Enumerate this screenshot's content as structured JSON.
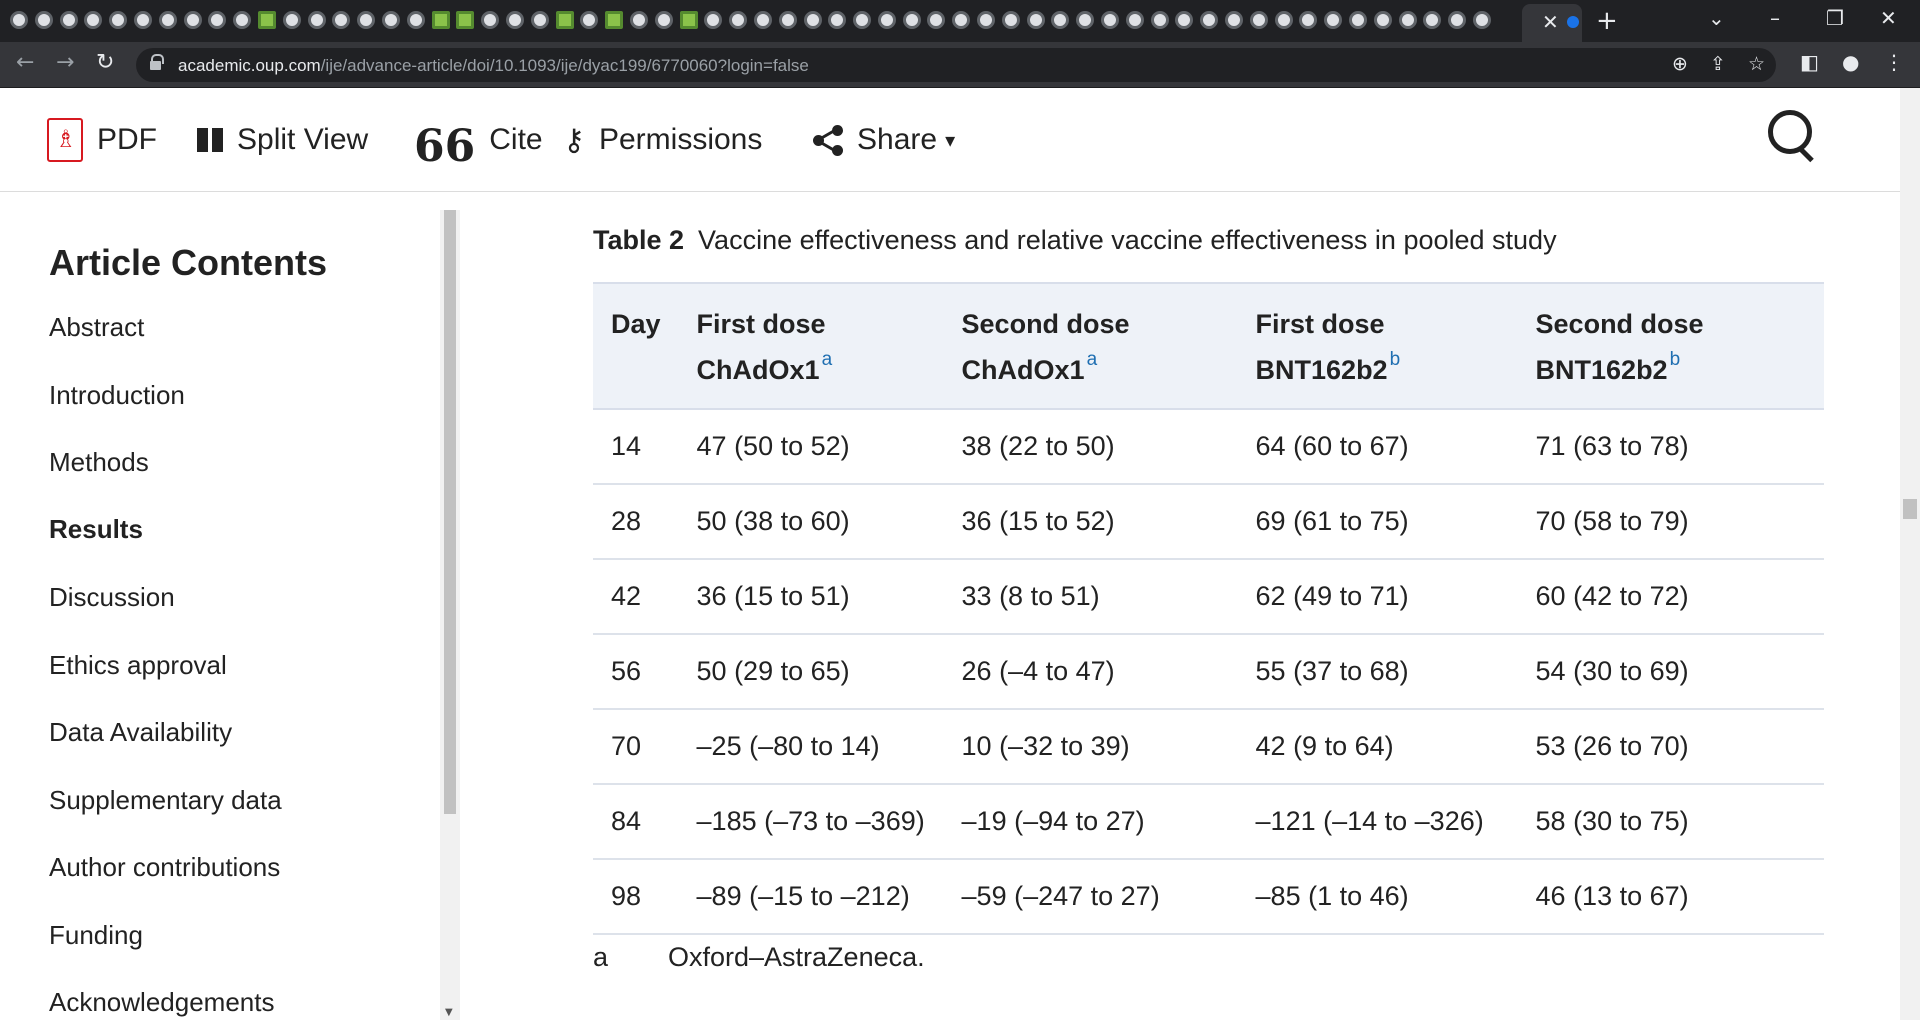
{
  "browser": {
    "url_host": "academic.oup.com",
    "url_path": "/ije/advance-article/doi/10.1093/ije/dyac199/6770060?login=false",
    "close_glyph": "✕",
    "newtab_glyph": "+"
  },
  "toolbar": {
    "pdf_label": "PDF",
    "split_label": "Split View",
    "cite_label": "Cite",
    "cite_glyph": "66",
    "permissions_label": "Permissions",
    "share_label": "Share",
    "share_caret": "▾"
  },
  "sidebar": {
    "title": "Article Contents",
    "items": [
      {
        "label": "Abstract",
        "active": false
      },
      {
        "label": "Introduction",
        "active": false
      },
      {
        "label": "Methods",
        "active": false
      },
      {
        "label": "Results",
        "active": true
      },
      {
        "label": "Discussion",
        "active": false
      },
      {
        "label": "Ethics approval",
        "active": false
      },
      {
        "label": "Data Availability",
        "active": false
      },
      {
        "label": "Supplementary data",
        "active": false
      },
      {
        "label": "Author contributions",
        "active": false
      },
      {
        "label": "Funding",
        "active": false
      },
      {
        "label": "Acknowledgements",
        "active": false
      }
    ]
  },
  "table": {
    "label": "Table 2",
    "caption": "Vaccine effectiveness and relative vaccine effectiveness in pooled study",
    "headers": [
      {
        "line1": "Day",
        "line2": "",
        "sup": ""
      },
      {
        "line1": "First dose",
        "line2": "ChAdOx1",
        "sup": "a"
      },
      {
        "line1": "Second dose",
        "line2": "ChAdOx1",
        "sup": "a"
      },
      {
        "line1": "First dose",
        "line2": "BNT162b2",
        "sup": "b"
      },
      {
        "line1": "Second dose",
        "line2": "BNT162b2",
        "sup": "b"
      }
    ],
    "rows": [
      [
        "14",
        "47 (50 to 52)",
        "38 (22 to 50)",
        "64 (60 to 67)",
        "71 (63 to 78)"
      ],
      [
        "28",
        "50 (38 to 60)",
        "36 (15 to 52)",
        "69 (61 to 75)",
        "70 (58 to 79)"
      ],
      [
        "42",
        "36 (15 to 51)",
        "33 (8 to 51)",
        "62 (49 to 71)",
        "60 (42 to 72)"
      ],
      [
        "56",
        "50 (29 to 65)",
        "26 (–4 to 47)",
        "55 (37 to 68)",
        "54 (30 to 69)"
      ],
      [
        "70",
        "–25 (–80 to 14)",
        "10 (–32 to 39)",
        "42 (9 to 64)",
        "53 (26 to 70)"
      ],
      [
        "84",
        "–185 (–73 to –369)",
        "–19 (–94 to 27)",
        "–121 (–14 to –326)",
        "58 (30 to 75)"
      ],
      [
        "98",
        "–89 (–15 to –212)",
        "–59 (–247 to 27)",
        "–85 (1 to 46)",
        "46 (13 to 67)"
      ]
    ],
    "footnote_key": "a",
    "footnote_text": "Oxford–AstraZeneca."
  }
}
